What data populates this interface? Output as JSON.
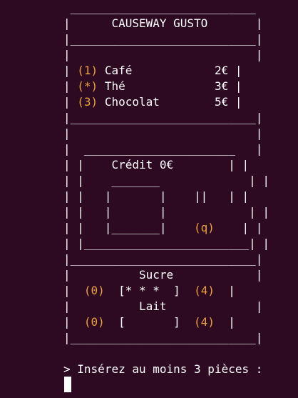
{
  "machine": {
    "name": "CAUSEWAY GUSTO",
    "products": [
      {
        "key": "(1)",
        "name": "Café",
        "price": "2€"
      },
      {
        "key": "(*)",
        "name": "Thé",
        "price": "3€"
      },
      {
        "key": "(3)",
        "name": "Chocolat",
        "price": "5€"
      }
    ],
    "credit_label": "Crédit",
    "credit_value": "0€",
    "coin_slot": "||",
    "quit_key": "(q)",
    "sugar": {
      "label": "Sucre",
      "min": "(0)",
      "level": "* * *",
      "max": "(4)"
    },
    "milk": {
      "label": "Lait",
      "min": "(0)",
      "level": "",
      "max": "(4)"
    }
  },
  "prompt": {
    "marker": ">",
    "text": "Insérez au moins 3 pièces :"
  },
  "colors": {
    "background": "#2d0922",
    "text": "#ffffff",
    "highlight": "#e8a33a"
  }
}
